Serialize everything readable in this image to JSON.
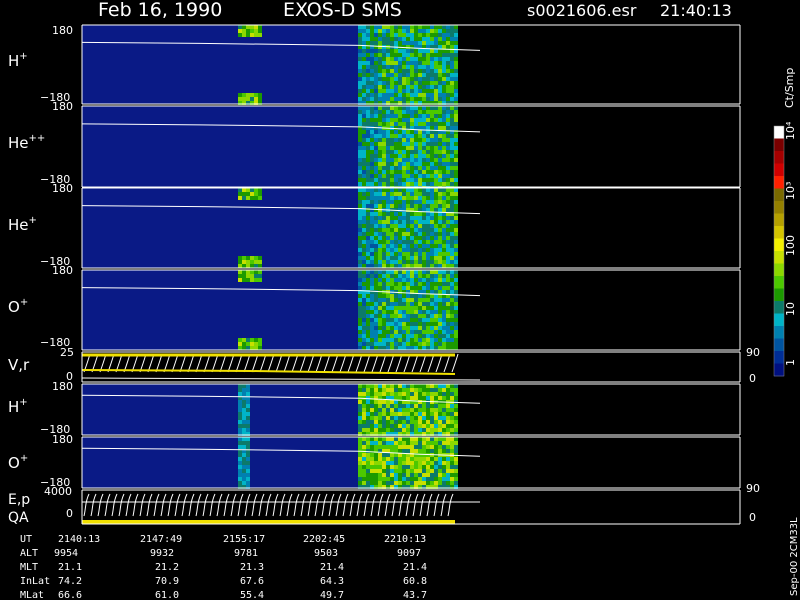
{
  "header": {
    "date": "Feb 16, 1990",
    "instrument": "EXOS-D SMS",
    "file": "s0021606.esr",
    "time": "21:40:13"
  },
  "colorbar": {
    "label": "Ct/Smp",
    "ticks": [
      "10⁴",
      "10³",
      "100",
      "10",
      "1"
    ],
    "colors": [
      "#ffffff",
      "#7a0000",
      "#a60000",
      "#d00000",
      "#ff2000",
      "#7a6a00",
      "#948000",
      "#b5a000",
      "#d4c400",
      "#f4f000",
      "#c8e000",
      "#8cd800",
      "#4cc800",
      "#1c9a00",
      "#0c7a6a",
      "#00b4c8",
      "#0080b0",
      "#0054a0",
      "#002e96",
      "#001080"
    ]
  },
  "panels": [
    {
      "label": "H",
      "sup": "+",
      "ymax": "180",
      "ymin": "−180"
    },
    {
      "label": "He",
      "sup": "++",
      "ymax": "180",
      "ymin": "−180"
    },
    {
      "label": "He",
      "sup": "+",
      "ymax": "180",
      "ymin": "−180"
    },
    {
      "label": "O",
      "sup": "+",
      "ymax": "180",
      "ymin": "−180"
    },
    {
      "label": "V,r",
      "sup": "",
      "ymax": "25",
      "ymin": "0",
      "right_max": "90",
      "right_min": "0"
    },
    {
      "label": "H",
      "sup": "+",
      "ymax": "180",
      "ymin": "−180"
    },
    {
      "label": "O",
      "sup": "+",
      "ymax": "180",
      "ymin": "−180"
    },
    {
      "label": "E,p",
      "sup": "",
      "label2": "QA",
      "ymax": "4000",
      "ymin": "0",
      "right_max": "90",
      "right_min": "0"
    }
  ],
  "footer": {
    "row_labels": [
      "UT",
      "ALT",
      "MLT",
      "InLat",
      "MLat"
    ],
    "columns": [
      [
        "2140:13",
        "9954",
        "21.1",
        "74.2",
        "66.6"
      ],
      [
        "2147:49",
        "9932",
        "21.2",
        "70.9",
        "61.0"
      ],
      [
        "2155:17",
        "9781",
        "21.3",
        "67.6",
        "55.4"
      ],
      [
        "2202:45",
        "9503",
        "21.4",
        "64.3",
        "49.7"
      ],
      [
        "2210:13",
        "9097",
        "21.4",
        "60.8",
        "43.7"
      ]
    ],
    "side_note": "Sep-00 2CM33L"
  },
  "chart_data": {
    "type": "heatmap",
    "title": "Feb 16, 1990   EXOS-D SMS",
    "x_ticks": [
      "2140:13",
      "2147:49",
      "2155:17",
      "2202:45",
      "2210:13"
    ],
    "y_range": [
      -180,
      180
    ],
    "colorbar_range": [
      1,
      10000
    ],
    "colorbar_scale": "log",
    "series": [
      {
        "name": "H+",
        "dense_from": "2202:45"
      },
      {
        "name": "He++",
        "dense_from": "2202:45"
      },
      {
        "name": "He+",
        "dense_from": "2202:45"
      },
      {
        "name": "O+",
        "dense_from": "2202:45"
      },
      {
        "name": "H+",
        "dense_from": "2202:45"
      },
      {
        "name": "O+",
        "dense_from": "2202:45"
      }
    ],
    "data_end": "2210:13"
  }
}
